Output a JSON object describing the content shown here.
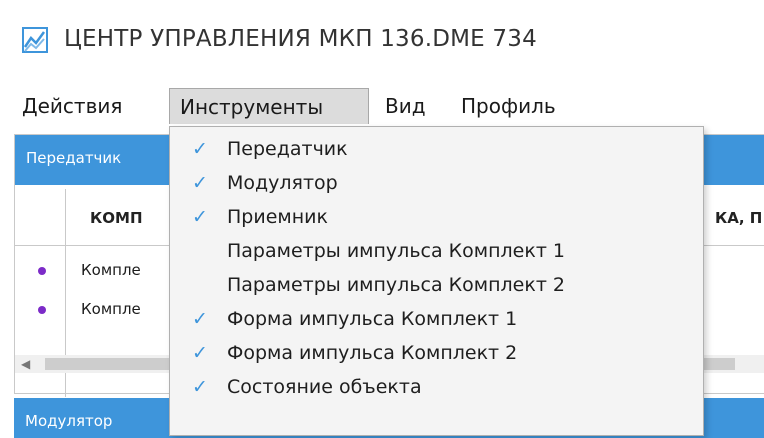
{
  "window": {
    "title": "ЦЕНТР УПРАВЛЕНИЯ  МКП 136.DME 734",
    "accent": "#3e95db"
  },
  "menubar": {
    "items": [
      {
        "label": "Действия"
      },
      {
        "label": "Инструменты",
        "active": true
      },
      {
        "label": "Вид"
      },
      {
        "label": "Профиль"
      }
    ]
  },
  "panel": {
    "title": "Передатчик",
    "columns": [
      "КОМП",
      "КА, П"
    ],
    "rows": [
      {
        "name": "Компле"
      },
      {
        "name": "Компле"
      }
    ],
    "status_color": "#7c2bc8"
  },
  "panel2": {
    "title": "Модулятор"
  },
  "dropdown": {
    "items": [
      {
        "label": "Передатчик",
        "checked": true
      },
      {
        "label": "Модулятор",
        "checked": true
      },
      {
        "label": "Приемник",
        "checked": true
      },
      {
        "label": "Параметры импульса Комплект 1",
        "checked": false
      },
      {
        "label": "Параметры импульса Комплект 2",
        "checked": false
      },
      {
        "label": "Форма импульса Комплект 1",
        "checked": true
      },
      {
        "label": "Форма импульса Комплект 2",
        "checked": true
      },
      {
        "label": "Состояние объекта",
        "checked": true
      }
    ],
    "check_glyph": "✓"
  }
}
